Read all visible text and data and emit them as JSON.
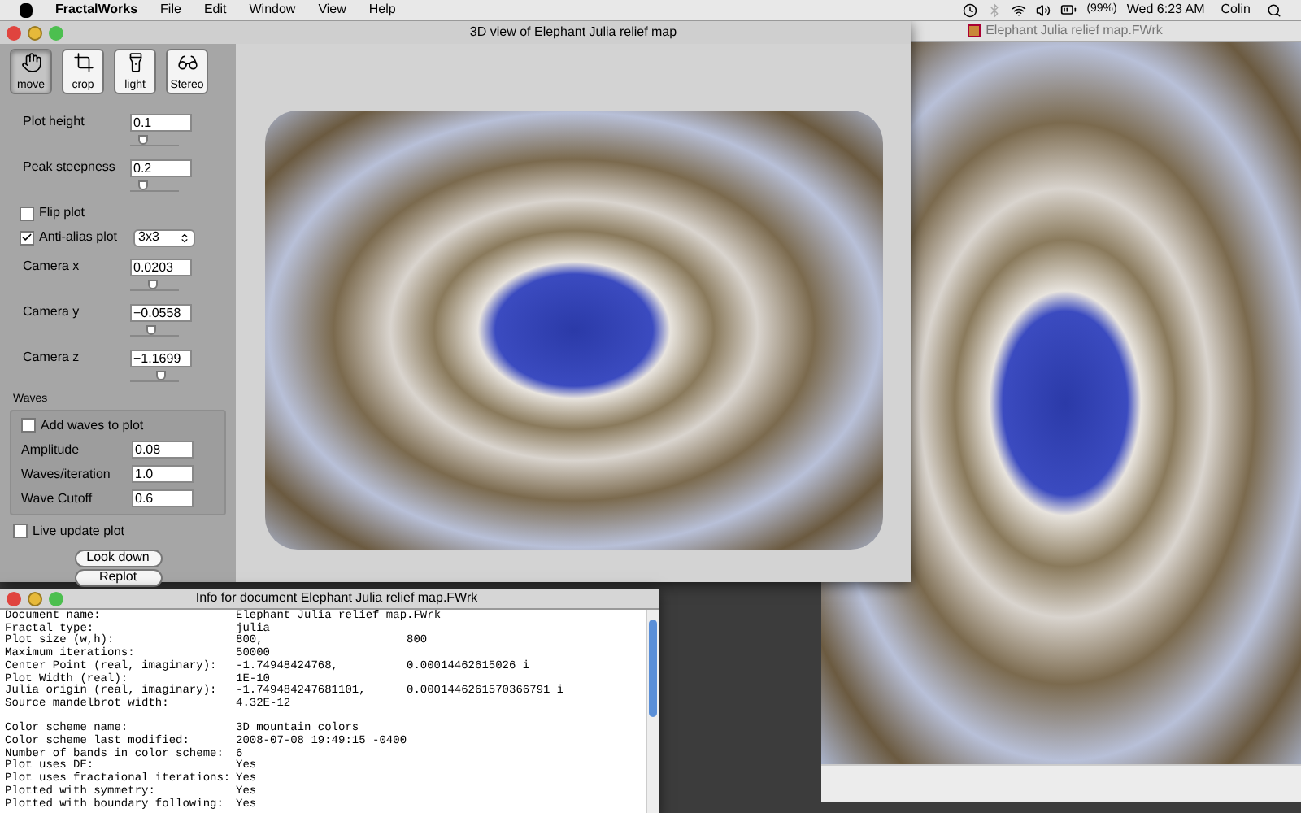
{
  "menubar": {
    "app": "FractalWorks",
    "menus": [
      "File",
      "Edit",
      "Window",
      "View",
      "Help"
    ],
    "battery": "(99%)",
    "clock": "Wed 6:23 AM",
    "user": "Colin"
  },
  "back_window": {
    "title": "Elephant Julia relief map.FWrk"
  },
  "main_window": {
    "title": "3D view of Elephant Julia relief map",
    "tools": [
      {
        "label": "move",
        "selected": true
      },
      {
        "label": "crop",
        "selected": false
      },
      {
        "label": "light",
        "selected": false
      },
      {
        "label": "Stereo",
        "selected": false
      }
    ],
    "controls": [
      {
        "kind": "field",
        "label": "Plot height",
        "value": "0.1",
        "level": 0.2
      },
      {
        "kind": "field",
        "label": "Peak steepness",
        "value": "0.2",
        "level": 0.2
      },
      {
        "kind": "checkbox",
        "label": "Flip plot",
        "checked": false
      },
      {
        "kind": "select",
        "label": "Anti-alias plot",
        "checked": true,
        "value": "3x3"
      },
      {
        "kind": "field",
        "label": "Camera x",
        "value": "0.0203",
        "level": 0.45
      },
      {
        "kind": "field",
        "label": "Camera y",
        "value": "−0.0558",
        "level": 0.42
      },
      {
        "kind": "field",
        "label": "Camera z",
        "value": "−1.1699",
        "level": 0.68
      }
    ],
    "waves": {
      "title": "Waves",
      "add_label": "Add waves to plot",
      "add_checked": false,
      "fields": [
        {
          "label": "Amplitude",
          "value": "0.08"
        },
        {
          "label": "Waves/iteration",
          "value": "1.0"
        },
        {
          "label": "Wave Cutoff",
          "value": "0.6"
        }
      ]
    },
    "live_update": {
      "label": "Live update plot",
      "checked": false
    },
    "buttons": [
      "Look down",
      "Replot"
    ]
  },
  "info_window": {
    "title": "Info for document Elephant Julia relief map.FWrk",
    "rows": [
      {
        "label": "Document name:",
        "values": [
          "Elephant Julia relief map.FWrk"
        ]
      },
      {
        "label": "Fractal type:",
        "values": [
          "julia"
        ]
      },
      {
        "label": "Plot size (w,h):",
        "values": [
          "800,",
          "800"
        ]
      },
      {
        "label": "Maximum iterations:",
        "values": [
          "50000"
        ]
      },
      {
        "label": "Center Point (real, imaginary):",
        "values": [
          "-1.74948424768,",
          "0.00014462615026 i"
        ]
      },
      {
        "label": "Plot Width (real):",
        "values": [
          "1E-10"
        ]
      },
      {
        "label": "Julia origin (real, imaginary):",
        "values": [
          "-1.749484247681101,",
          "0.0001446261570366791 i"
        ]
      },
      {
        "label": "Source mandelbrot width:",
        "values": [
          "4.32E-12"
        ]
      },
      {
        "kind": "blank"
      },
      {
        "label": "Color scheme name:",
        "values": [
          "3D mountain colors"
        ]
      },
      {
        "label": "Color scheme last modified:",
        "values": [
          "2008-07-08 19:49:15 -0400"
        ]
      },
      {
        "label": "Number of bands in color scheme:",
        "values": [
          "6"
        ]
      },
      {
        "label": "Plot uses DE:",
        "values": [
          "Yes"
        ]
      },
      {
        "label": "Plot uses fractaional iterations:",
        "values": [
          "Yes"
        ]
      },
      {
        "label": "Plotted with symmetry:",
        "values": [
          "Yes"
        ]
      },
      {
        "label": "Plotted with boundary following:",
        "values": [
          "Yes"
        ]
      }
    ]
  }
}
